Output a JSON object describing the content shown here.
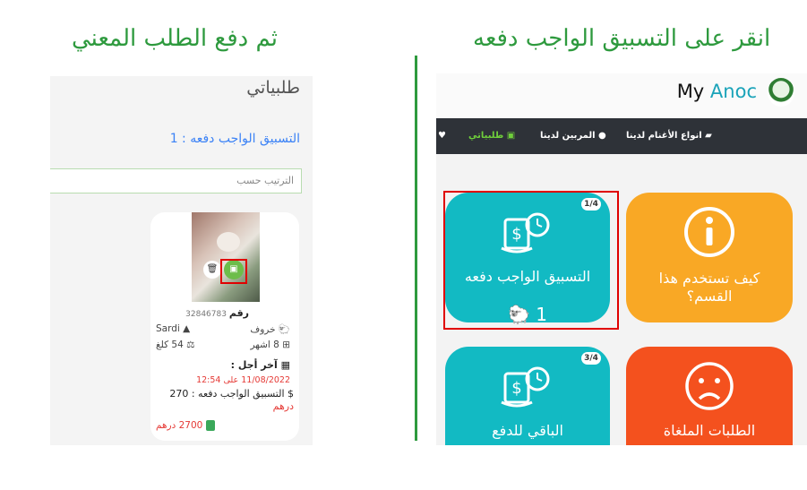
{
  "headings": {
    "left": "ثم دفع الطلب المعني",
    "right": "انقر على التسبيق الواجب دفعه"
  },
  "left_panel": {
    "title": "طلبياتي",
    "pending_link": "التسبيق الواجب دفعه : 1",
    "sort_placeholder": "الترتيب حسب",
    "card": {
      "number_label": "رقم",
      "number_value": "32846783",
      "type": "خروف",
      "breed": "Sardi",
      "age": "8 اشهر",
      "weight": "54 كلغ",
      "deadline_label": "آخر أجل :",
      "deadline_value": "11/08/2022 على 12:54",
      "fee_label": "التسبيق الواجب دفعه : 270",
      "fee_unit": "درهم",
      "total": "2700 درهم"
    }
  },
  "right_panel": {
    "logo": {
      "part1": "My ",
      "part2": "Anoc"
    },
    "nav": {
      "orders": "طلبياتي",
      "breeders": "المربين لدينا",
      "sheep_types": "انواع الأغنام لدينا"
    },
    "tiles": [
      {
        "id": "pay-deposit",
        "label": "التسبيق الواجب دفعه",
        "badge": "1/4",
        "count": "1",
        "color": "#12bac3",
        "icon": "payment-clock-icon"
      },
      {
        "id": "how-to-use",
        "label": "كيف تستخدم هذا القسم؟",
        "color": "#f9a825",
        "icon": "info-icon"
      },
      {
        "id": "remaining-to-pay",
        "label": "الباقي للدفع",
        "badge": "3/4",
        "color": "#12bac3",
        "icon": "payment-clock-icon"
      },
      {
        "id": "cancelled-orders",
        "label": "الطلبات الملغاة",
        "color": "#f4511e",
        "icon": "sad-face-icon"
      }
    ]
  },
  "colors": {
    "heading_green": "#2e9a3e",
    "teal": "#12bac3",
    "orange": "#f9a825",
    "red_orange": "#f4511e",
    "highlight_red": "#e00000",
    "navbar": "#2e3238",
    "nav_active": "#6fcf3b"
  }
}
